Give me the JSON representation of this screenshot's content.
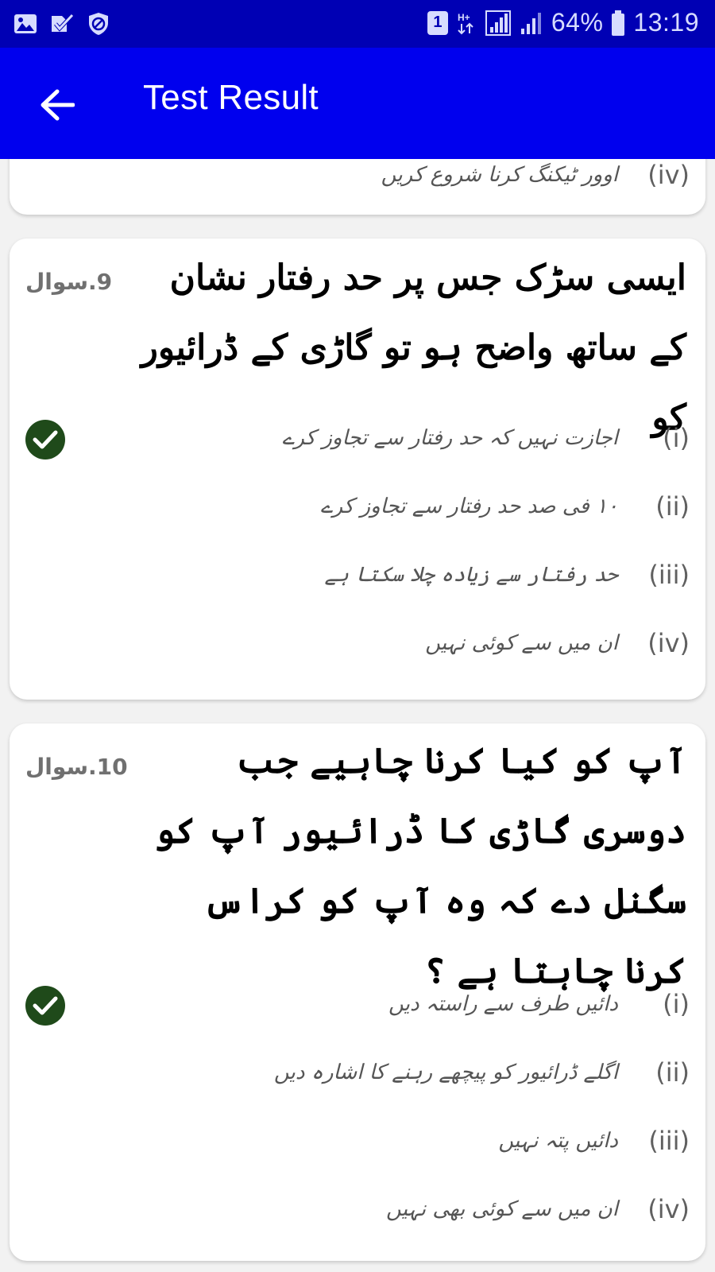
{
  "status_bar": {
    "sim_badge": "1",
    "battery": "64%",
    "time": "13:19"
  },
  "app_bar": {
    "title": "Test Result"
  },
  "partial_card": {
    "option_label": "(iv)",
    "option_text": "اوور ٹیکنگ کرنا شروع کریں"
  },
  "questions": [
    {
      "number": "9.سوال",
      "text": "ایسی سڑک جس پر حد رفتار نشان کے ساتھ واضح ہو تو گاڑی کے ڈرائیور کو",
      "options": [
        {
          "label": "(i)",
          "text": "اجازت نہیں کہ حد رفتار سے تجاوز کرے"
        },
        {
          "label": "(ii)",
          "text": "۱۰ فی صد حد رفتار سے تجاوز کرے"
        },
        {
          "label": "(iii)",
          "text": "حد رفتار سے زیادہ چلا سکتا ہے"
        },
        {
          "label": "(iv)",
          "text": "ان میں سے کوئی نہیں"
        }
      ]
    },
    {
      "number": "10.سوال",
      "text": "آپ کو کیا کرنا چاہیے جب دوسری گاڑی کا ڈرائیور آپ کو سگنل دے کہ وہ آپ کو کراس کرنا چاہتا ہے ؟",
      "options": [
        {
          "label": "(i)",
          "text": "دائیں طرف سے راستہ دیں"
        },
        {
          "label": "(ii)",
          "text": "اگلے ڈرائیور کو پیچھے رہنے کا اشارہ دیں"
        },
        {
          "label": "(iii)",
          "text": "دائیں پتہ نہیں"
        },
        {
          "label": "(iv)",
          "text": "ان میں سے کوئی بھی نہیں"
        }
      ]
    }
  ],
  "icons": {
    "status_left": [
      "image-icon",
      "checklist-icon",
      "shield-icon"
    ],
    "correct_marker": "check-circle-icon"
  },
  "colors": {
    "status_bar": "#0000b4",
    "app_bar": "#0000ee",
    "correct_marker": "#1f4a1a"
  }
}
